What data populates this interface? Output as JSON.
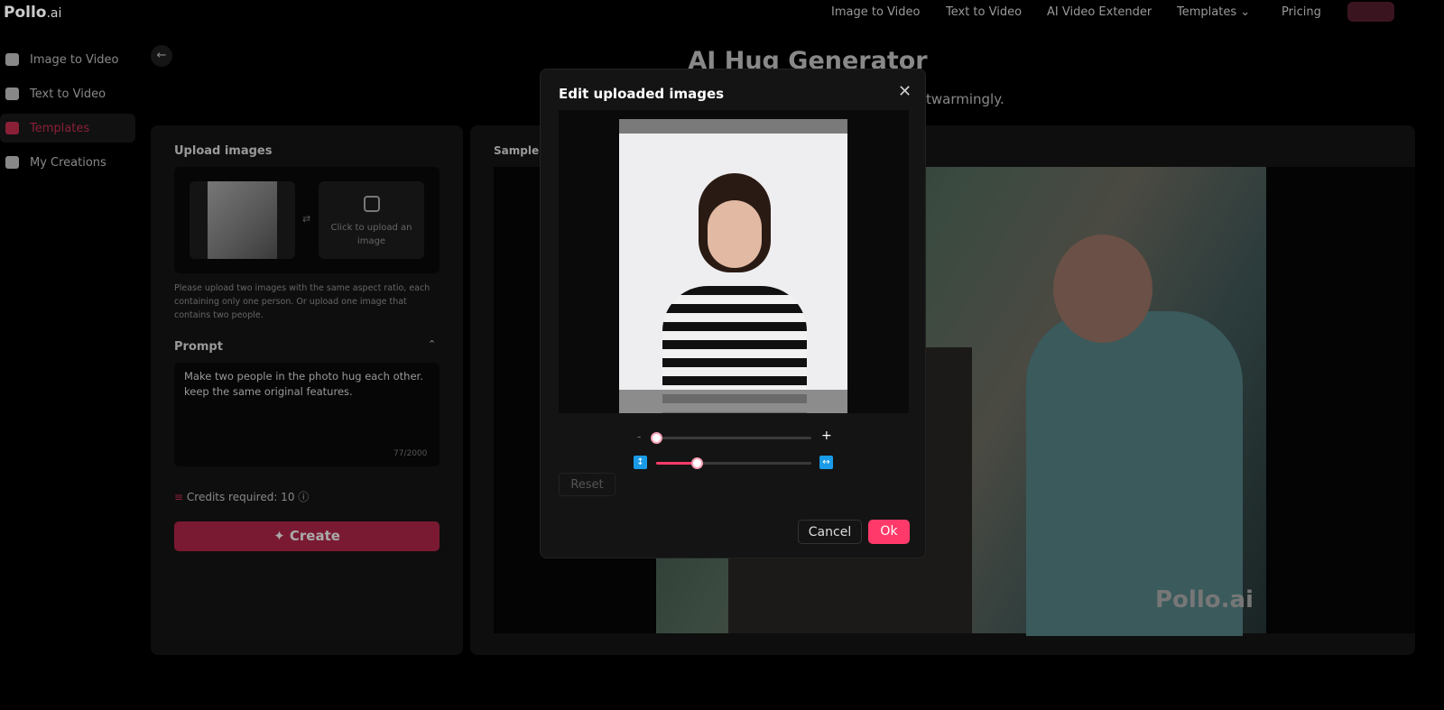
{
  "header": {
    "logo": "Pollo",
    "logo_suffix": ".ai",
    "nav": [
      "Image to Video",
      "Text to Video",
      "AI Video Extender",
      "Templates",
      "Pricing"
    ]
  },
  "sidebar": {
    "items": [
      {
        "label": "Image to Video",
        "icon": "image-video-icon"
      },
      {
        "label": "Text to Video",
        "icon": "text-video-icon"
      },
      {
        "label": "Templates",
        "icon": "templates-icon",
        "active": true
      },
      {
        "label": "My Creations",
        "icon": "folder-icon"
      }
    ]
  },
  "page": {
    "title": "AI Hug Generator",
    "subtitle_visible": "twarmingly."
  },
  "form": {
    "upload_label": "Upload images",
    "upload_placeholder": "Click to upload an image",
    "help": "Please upload two images with the same aspect ratio, each containing only one person. Or upload one image that contains two people.",
    "prompt_label": "Prompt",
    "prompt_value": "Make two people in the photo hug each other. keep the same original features.",
    "prompt_count": "77/2000",
    "credits": "Credits required: 10",
    "create_label": "Create"
  },
  "sample": {
    "label": "Sample Video",
    "watermark": "Pollo.ai"
  },
  "modal": {
    "title": "Edit uploaded images",
    "zoom_value_percent": 0,
    "ratio_value_percent": 26,
    "reset": "Reset",
    "cancel": "Cancel",
    "ok": "Ok",
    "minus": "-",
    "plus": "+"
  },
  "colors": {
    "accent": "#ff3a6a",
    "slider_icon": "#1a9be8"
  }
}
